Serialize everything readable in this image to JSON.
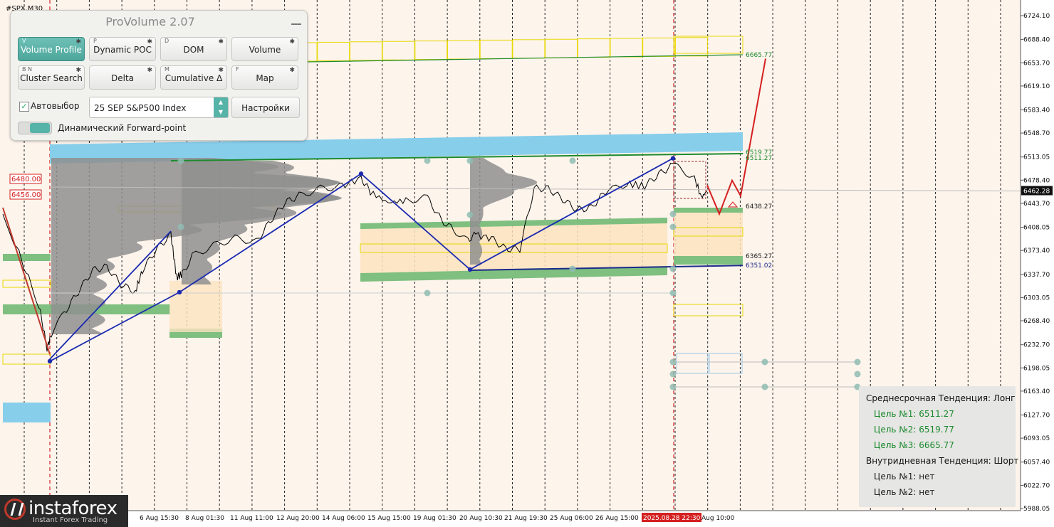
{
  "symbol": "#SPX,M30",
  "panel": {
    "title": "ProVolume 2.07",
    "buttons": [
      {
        "key": "V",
        "label": "Volume Profile",
        "active": true
      },
      {
        "key": "P",
        "label": "Dynamic POC",
        "active": false
      },
      {
        "key": "D",
        "label": "DOM",
        "active": false
      },
      {
        "key": "",
        "label": "Volume",
        "active": false
      },
      {
        "key": "B  N",
        "label": "Cluster Search",
        "active": false
      },
      {
        "key": "",
        "label": "Delta",
        "active": false
      },
      {
        "key": "M",
        "label": "Cumulative Δ",
        "active": false
      },
      {
        "key": "F",
        "label": "Map",
        "active": false
      }
    ],
    "autoselect_label": "Автовыбор",
    "autoselect_checked": true,
    "instrument": "25 SEP S&P500 Index",
    "settings_label": "Настройки",
    "forward_label": "Динамический Forward-point"
  },
  "trend_box": {
    "midterm": "Среднесрочная Тенденция: Лонг",
    "targets_long": [
      "Цель №1: 6511.27",
      "Цель №2: 6519.77",
      "Цель №3: 6665.77"
    ],
    "intraday": "Внутридневная Тенденция: Шорт",
    "targets_short": [
      "Цель №1: нет",
      "Цель №2: нет"
    ]
  },
  "logo": {
    "name": "instaforex",
    "tagline": "Instant Forex Trading"
  },
  "chart_data": {
    "type": "line",
    "title": "#SPX,M30",
    "y_range": [
      5986.0,
      6738.0
    ],
    "y_ticks": [
      6724.1,
      6688.4,
      6653.7,
      6619.1,
      6583.4,
      6548.7,
      6513.05,
      6478.4,
      6443.7,
      6408.05,
      6373.4,
      6337.7,
      6303.05,
      6268.4,
      6232.7,
      6198.05,
      6163.4,
      6127.7,
      6093.05,
      6057.4,
      6022.7,
      5988.05
    ],
    "x_labels": [
      "6 Aug 15:30",
      "8 Aug 01:30",
      "11 Aug 11:00",
      "12 Aug 20:00",
      "14 Aug 06:00",
      "15 Aug 15:00",
      "19 Aug 01:30",
      "20 Aug 10:30",
      "21 Aug 19:30",
      "25 Aug 06:00",
      "26 Aug 15:00",
      "2025.08.28 22:30",
      "Aug 10:00"
    ],
    "current_price_label": "6462.28",
    "current_price": 6462.28,
    "left_price_labels": [
      "6480.00",
      "6456.00"
    ],
    "left_prices": [
      6480.0,
      6456.0
    ],
    "level_labels": [
      {
        "text": "6665.77",
        "value": 6665.77,
        "color": "#1c8a2e"
      },
      {
        "text": "6519.77",
        "value": 6519.77,
        "color": "#1c8a2e"
      },
      {
        "text": "6511.27",
        "value": 6511.27,
        "color": "#1c8a2e"
      },
      {
        "text": "6438.27",
        "value": 6438.27,
        "color": "#222222"
      },
      {
        "text": "6365.27",
        "value": 6365.27,
        "color": "#222222"
      },
      {
        "text": "6351.02",
        "value": 6351.02,
        "color": "#1a2a8a"
      }
    ],
    "zigzag": [
      [
        70,
        6208
      ],
      [
        252,
        6311
      ],
      [
        507,
        6488
      ],
      [
        660,
        6345
      ],
      [
        945,
        6511
      ]
    ],
    "forecast": [
      [
        993,
        6471
      ],
      [
        1010,
        6428
      ],
      [
        1028,
        6478
      ],
      [
        1040,
        6455
      ],
      [
        1075,
        6660
      ]
    ],
    "grid": true,
    "colors": {
      "background": "#fdf4ec",
      "price": "#000000",
      "zigzag": "#1a2ab0",
      "forecast": "#d42020",
      "green_zone": "#7fbf7f",
      "blue_zone": "#87ceeb",
      "yellow_box": "#e8d800"
    }
  }
}
